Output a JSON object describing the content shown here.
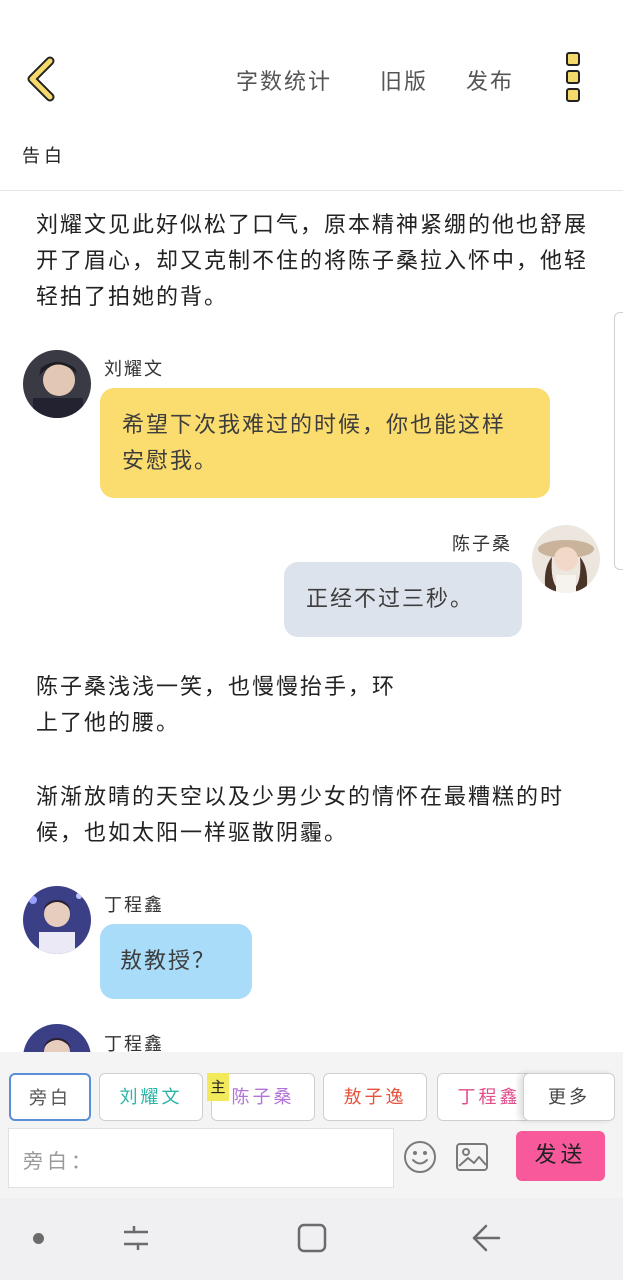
{
  "header": {
    "word_count": "字数统计",
    "old_version": "旧版",
    "publish": "发布",
    "document_title": "告白"
  },
  "story": [
    {
      "type": "narration",
      "text": "刘耀文见此好似松了口气，原本精神紧绷的他也舒展开了眉心，却又克制不住的将陈子桑拉入怀中，他轻轻拍了拍她的背。"
    },
    {
      "type": "message",
      "side": "left",
      "name": "刘耀文",
      "text": "希望下次我难过的时候，你也能这样安慰我。",
      "bubble_color": "#fbdc6e"
    },
    {
      "type": "message",
      "side": "right",
      "name": "陈子桑",
      "text": "正经不过三秒。",
      "bubble_color": "#dde3ec"
    },
    {
      "type": "narration",
      "text_line1": "陈子桑浅浅一笑，也慢慢抬手，环",
      "text_line2": "上了他的腰。"
    },
    {
      "type": "narration",
      "text": "渐渐放晴的天空以及少男少女的情怀在最糟糕的时候，也如太阳一样驱散阴霾。"
    },
    {
      "type": "message",
      "side": "left",
      "name": "丁程鑫",
      "text": "敖教授？",
      "bubble_color": "#a9dcf8"
    },
    {
      "type": "message",
      "side": "left",
      "name": "丁程鑫",
      "text": ""
    }
  ],
  "composer": {
    "roles": [
      {
        "label": "旁白",
        "color": "#555555",
        "selected": true
      },
      {
        "label": "刘耀文",
        "color": "#2bb5a7"
      },
      {
        "label": "陈子桑",
        "color": "#b473d9",
        "badge": "主"
      },
      {
        "label": "敖子逸",
        "color": "#e5533d"
      },
      {
        "label": "丁程鑫",
        "color": "#e34b8a"
      }
    ],
    "more": "更多",
    "input_placeholder": "旁白：",
    "send": "发送"
  },
  "colors": {
    "accent_yellow": "#f5d96b",
    "send_pink": "#f7599a"
  }
}
